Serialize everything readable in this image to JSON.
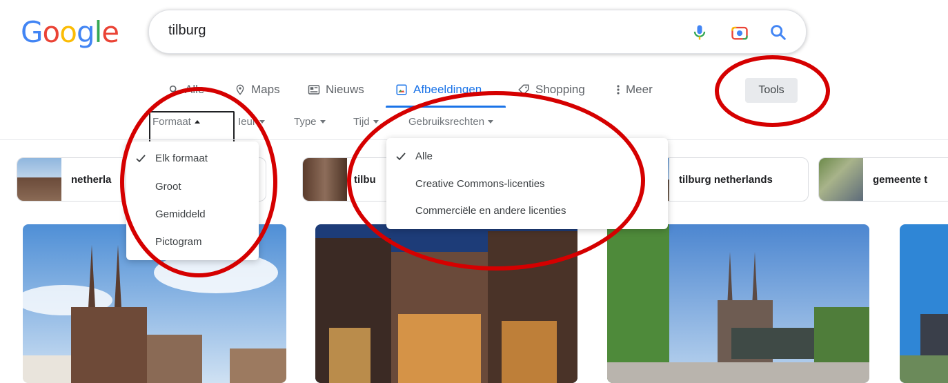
{
  "logo": {
    "letters": [
      "G",
      "o",
      "o",
      "g",
      "l",
      "e"
    ],
    "colors": [
      "#4285F4",
      "#EA4335",
      "#FBBC05",
      "#4285F4",
      "#34A853",
      "#EA4335"
    ]
  },
  "search": {
    "query": "tilburg",
    "icons": [
      "microphone-icon",
      "camera-icon",
      "search-icon"
    ]
  },
  "tabs": [
    {
      "label": "Alle",
      "icon": "search-icon"
    },
    {
      "label": "Maps",
      "icon": "map-pin-icon"
    },
    {
      "label": "Nieuws",
      "icon": "newspaper-icon"
    },
    {
      "label": "Afbeeldingen",
      "icon": "image-icon",
      "active": true
    },
    {
      "label": "Shopping",
      "icon": "tag-icon"
    },
    {
      "label": "Meer",
      "icon": "more-vertical-icon"
    }
  ],
  "tools": {
    "label": "Tools"
  },
  "filters": [
    {
      "label": "Formaat",
      "open": true
    },
    {
      "label": "Kleur",
      "visible_text": "Ieur"
    },
    {
      "label": "Type"
    },
    {
      "label": "Tijd",
      "visible_text": "Tijd"
    },
    {
      "label": "Gebruiksrechten",
      "open": true
    }
  ],
  "formaat_menu": {
    "items": [
      {
        "label": "Elk formaat",
        "selected": true
      },
      {
        "label": "Groot"
      },
      {
        "label": "Gemiddeld"
      },
      {
        "label": "Pictogram"
      }
    ]
  },
  "rights_menu": {
    "items": [
      {
        "label": "Alle",
        "selected": true
      },
      {
        "label": "Creative Commons-licenties"
      },
      {
        "label": "Commerciële en andere licenties"
      }
    ]
  },
  "chips": [
    {
      "label": "netherla"
    },
    {
      "label": "tilbu"
    },
    {
      "label": "tilburg netherlands"
    },
    {
      "label": "gemeente t"
    }
  ],
  "colors": {
    "accent": "#1a73e8",
    "annotation": "#d50000"
  }
}
